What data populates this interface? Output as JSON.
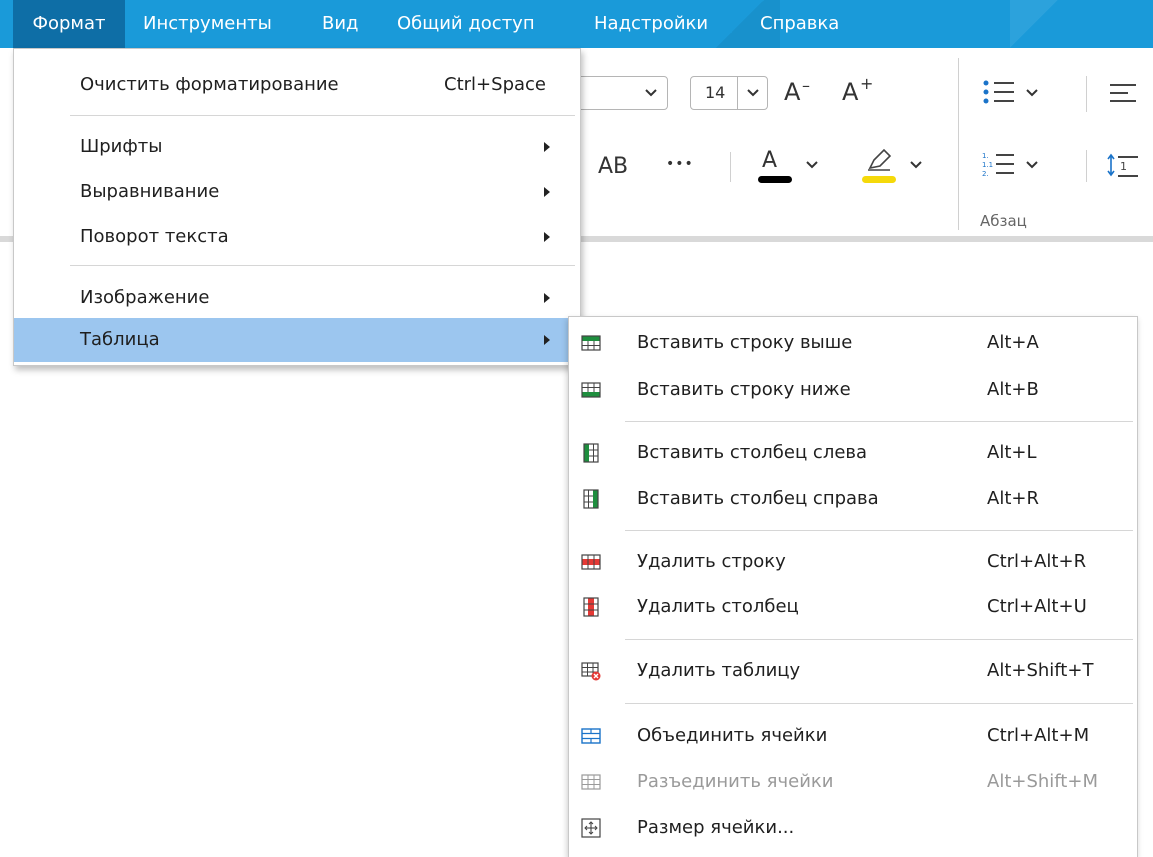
{
  "menubar": {
    "items": [
      {
        "label": "Формат"
      },
      {
        "label": "Инструменты"
      },
      {
        "label": "Вид"
      },
      {
        "label": "Общий доступ"
      },
      {
        "label": "Надстройки"
      },
      {
        "label": "Справка"
      }
    ]
  },
  "toolbar": {
    "font_size": "14",
    "decrease_font": "A",
    "increase_font": "A",
    "case_label": "AB",
    "more_label": "•••",
    "font_color_label": "A",
    "paragraph_group_label": "Абзац",
    "font_color": "#000000",
    "highlight_color": "#f5d90a"
  },
  "format_menu": {
    "items": [
      {
        "label": "Очистить форматирование",
        "shortcut": "Ctrl+Space"
      },
      {
        "label": "Шрифты"
      },
      {
        "label": "Выравнивание"
      },
      {
        "label": "Поворот текста"
      },
      {
        "label": "Изображение"
      },
      {
        "label": "Таблица"
      }
    ]
  },
  "table_submenu": {
    "items": [
      {
        "label": "Вставить строку выше",
        "shortcut": "Alt+A",
        "icon": "insert-row-above-icon"
      },
      {
        "label": "Вставить строку ниже",
        "shortcut": "Alt+B",
        "icon": "insert-row-below-icon"
      },
      {
        "label": "Вставить столбец слева",
        "shortcut": "Alt+L",
        "icon": "insert-column-left-icon"
      },
      {
        "label": "Вставить столбец справа",
        "shortcut": "Alt+R",
        "icon": "insert-column-right-icon"
      },
      {
        "label": "Удалить строку",
        "shortcut": "Ctrl+Alt+R",
        "icon": "delete-row-icon"
      },
      {
        "label": "Удалить столбец",
        "shortcut": "Ctrl+Alt+U",
        "icon": "delete-column-icon"
      },
      {
        "label": "Удалить таблицу",
        "shortcut": "Alt+Shift+T",
        "icon": "delete-table-icon"
      },
      {
        "label": "Объединить ячейки",
        "shortcut": "Ctrl+Alt+M",
        "icon": "merge-cells-icon"
      },
      {
        "label": "Разъединить ячейки",
        "shortcut": "Alt+Shift+M",
        "icon": "split-cells-icon",
        "disabled": true
      },
      {
        "label": "Размер ячейки...",
        "shortcut": "",
        "icon": "cell-size-icon"
      }
    ]
  },
  "colors": {
    "menubar_bg": "#1a9ad9",
    "menu_active_bg": "#0e6ea6",
    "highlight_bg": "#9cc6ef",
    "insert_green": "#1e8e3e",
    "delete_red": "#e53935",
    "merge_blue": "#1a73c9"
  }
}
